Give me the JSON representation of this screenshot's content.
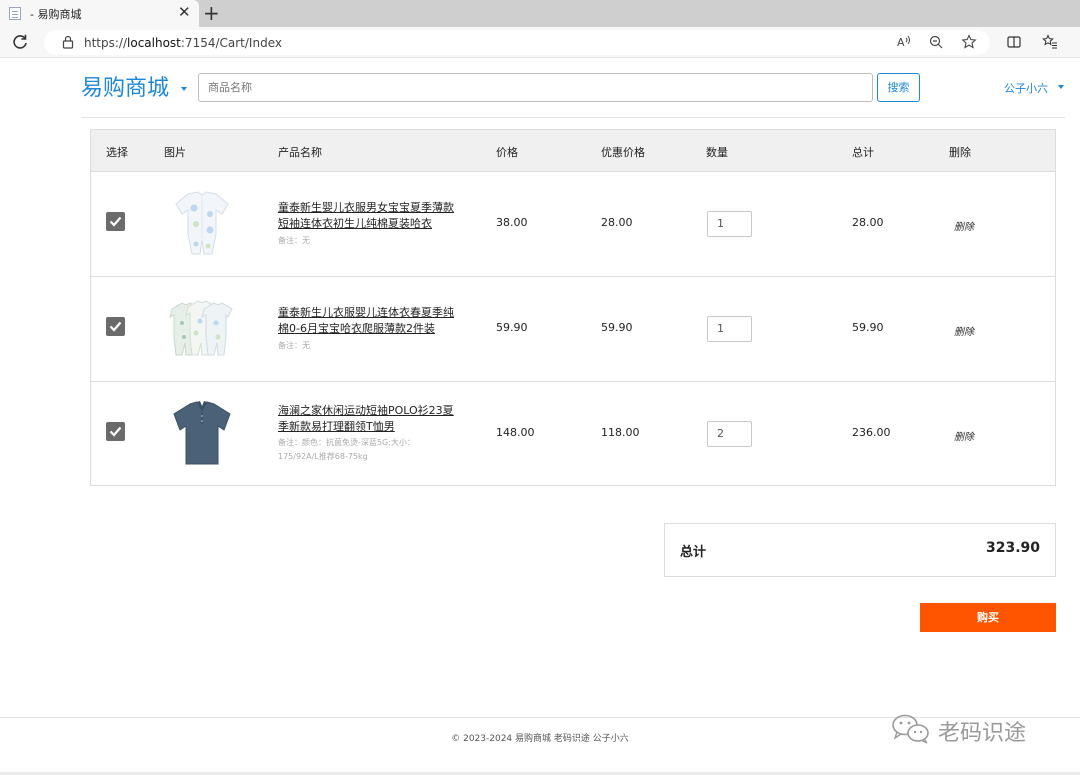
{
  "browser": {
    "tab_title": "- 易购商城",
    "url_scheme": "https://",
    "url_host": "localhost",
    "url_path": ":7154/Cart/Index"
  },
  "header": {
    "brand": "易购商城",
    "search_placeholder": "商品名称",
    "search_button": "搜索",
    "user": "公子小六"
  },
  "cart": {
    "columns": [
      "选择",
      "图片",
      "产品名称",
      "价格",
      "优惠价格",
      "数量",
      "总计",
      "删除"
    ],
    "items": [
      {
        "checked": true,
        "name": "童泰新生婴儿衣服男女宝宝夏季薄款短袖连体衣初生儿纯棉夏装哈衣",
        "note": "备注：无",
        "price": "38.00",
        "discount_price": "28.00",
        "quantity": "1",
        "total": "28.00",
        "delete_label": "删除",
        "image_icon": "baby-romper-icon"
      },
      {
        "checked": true,
        "name": "童泰新生儿衣服婴儿连体衣春夏季纯棉0-6月宝宝哈衣爬服薄款2件装",
        "note": "备注：无",
        "price": "59.90",
        "discount_price": "59.90",
        "quantity": "1",
        "total": "59.90",
        "delete_label": "删除",
        "image_icon": "baby-onesies-icon"
      },
      {
        "checked": true,
        "name": "海澜之家休闲运动短袖POLO衫23夏季新款易打理翻领T恤男",
        "note": "备注：颜色：抗菌免烫-深蓝5G;大小：175/92A/L推荐68-75kg",
        "price": "148.00",
        "discount_price": "118.00",
        "quantity": "2",
        "total": "236.00",
        "delete_label": "删除",
        "image_icon": "polo-shirt-icon"
      }
    ]
  },
  "summary": {
    "label": "总计",
    "value": "323.90"
  },
  "buy_button": "购买",
  "footer": "© 2023-2024 易购商城 老码识途 公子小六",
  "watermark": "老码识途",
  "colors": {
    "brand": "#1e88d8",
    "buy": "#ff5500",
    "checkbox": "#6b6b6b",
    "header_bg": "#f0f0f0"
  }
}
